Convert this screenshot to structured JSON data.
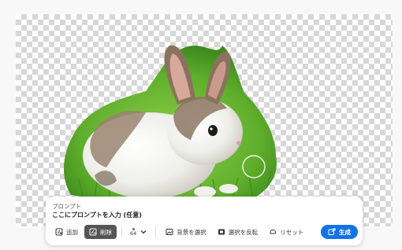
{
  "prompt": {
    "label": "プロンプト",
    "input_value": "ここにプロンプトを入力 (任意)"
  },
  "toolbar": {
    "add_label": "追加",
    "delete_label": "削除",
    "brush_size": "64",
    "select_background_label": "背景を選択",
    "invert_selection_label": "選択を反転",
    "reset_label": "リセット",
    "generate_label": "生成"
  },
  "colors": {
    "accent": "#1473e6",
    "active_tool": "#555555"
  },
  "icons": [
    "add-brush-icon",
    "delete-brush-icon",
    "chevron-down-icon",
    "select-background-icon",
    "invert-selection-icon",
    "reset-icon",
    "generate-icon"
  ]
}
